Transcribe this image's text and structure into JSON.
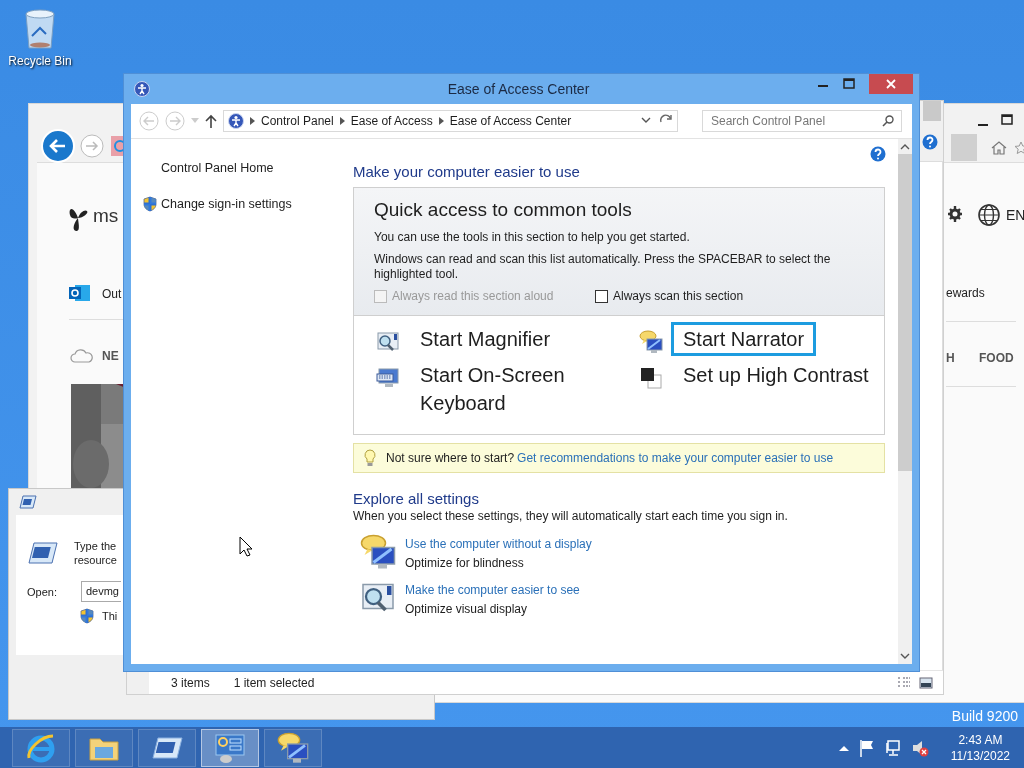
{
  "desktop": {
    "icons": [
      {
        "label": "Recycle Bin"
      }
    ],
    "build": "Build 9200"
  },
  "browser_window": {
    "logo": "ms",
    "mail_link": "Out",
    "weather_tab": "NE",
    "language": "EN",
    "rewards_link": "ewards",
    "categories": [
      "H",
      "FOOD"
    ]
  },
  "run_dialog": {
    "prompt": [
      "Type the",
      "resource"
    ],
    "open_label": "Open:",
    "open_value": "devmg",
    "note": "Thi"
  },
  "explorer_window": {
    "status_bar": [
      "3 items",
      "1 item selected"
    ]
  },
  "main_window": {
    "title": "Ease of Access Center",
    "breadcrumb": [
      "Control Panel",
      "Ease of Access",
      "Ease of Access Center"
    ],
    "search": {
      "placeholder": "Search Control Panel"
    },
    "sidebar": {
      "items": [
        {
          "label": "Control Panel Home",
          "kind": "link"
        },
        {
          "label": "Change sign-in settings",
          "kind": "shield-link"
        }
      ]
    },
    "heading": "Make your computer easier to use",
    "quick_access": {
      "title": "Quick access to common tools",
      "intro": "You can use the tools in this section to help you get started.",
      "scan_note": "Windows can read and scan this list automatically.  Press the SPACEBAR to select the highlighted tool.",
      "options": [
        {
          "label": "Always read this section aloud",
          "checked": false,
          "disabled": true
        },
        {
          "label": "Always scan this section",
          "checked": false,
          "disabled": false
        }
      ],
      "tools": [
        {
          "label": "Start Magnifier",
          "kind": "magnifier",
          "selected": false
        },
        {
          "label": "Start Narrator",
          "kind": "narrator",
          "selected": true
        },
        {
          "label": "Start On-Screen Keyboard",
          "kind": "keyboard",
          "selected": false
        },
        {
          "label": "Set up High Contrast",
          "kind": "contrast",
          "selected": false
        }
      ]
    },
    "tip": {
      "text": "Not sure where to start?",
      "link": "Get recommendations to make your computer easier to use"
    },
    "explore": {
      "title": "Explore all settings",
      "intro": "When you select these settings, they will automatically start each time you sign in.",
      "items": [
        {
          "link": "Use the computer without a display",
          "description": "Optimize for blindness",
          "kind": "narrator"
        },
        {
          "link": "Make the computer easier to see",
          "description": "Optimize visual display",
          "kind": "magnifier"
        }
      ]
    }
  },
  "taskbar": {
    "buttons": [
      {
        "kind": "browser",
        "selected": false
      },
      {
        "kind": "folder",
        "selected": false
      },
      {
        "kind": "run",
        "selected": false
      },
      {
        "kind": "control-panel",
        "selected": true
      },
      {
        "kind": "narrator",
        "selected": false
      }
    ],
    "tray": {
      "time": "2:43 AM",
      "date": "11/13/2022"
    }
  }
}
